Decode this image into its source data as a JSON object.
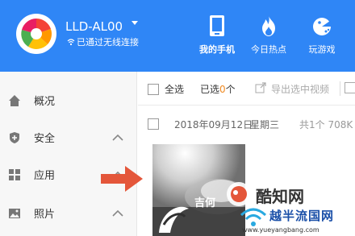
{
  "header": {
    "device_name": "LLD-AL00",
    "connection_status": "已通过无线连接",
    "nav": [
      {
        "label": "我的手机",
        "icon": "phone-icon",
        "active": true
      },
      {
        "label": "今日热点",
        "icon": "flame-icon",
        "active": false
      },
      {
        "label": "玩游戏",
        "icon": "gamepad-icon",
        "active": false
      }
    ],
    "accent_color": "#2f86f6"
  },
  "sidebar": {
    "items": [
      {
        "label": "概况",
        "icon": "home-icon"
      },
      {
        "label": "安全",
        "icon": "shield-icon"
      },
      {
        "label": "应用",
        "icon": "apps-grid-icon"
      },
      {
        "label": "照片",
        "icon": "image-icon"
      }
    ]
  },
  "toolbar": {
    "select_all": "全选",
    "selected_prefix": "已选",
    "selected_count": "0",
    "selected_suffix": "个",
    "export_label": "导出选中视频"
  },
  "group": {
    "date": "2018年09月12日",
    "weekday": "星期三",
    "count_text": "共1个 708K"
  },
  "watermark": {
    "brand": "酷知网",
    "site_text": "越半流国网",
    "site_url": "www.yueyangbang.com"
  },
  "thumbnail_caption": "吉何"
}
